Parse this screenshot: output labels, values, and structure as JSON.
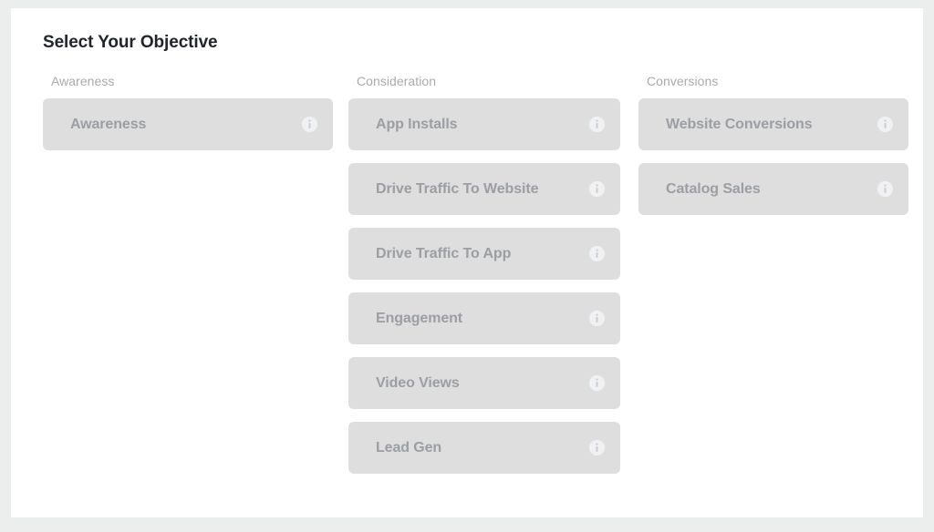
{
  "panel": {
    "title": "Select Your Objective"
  },
  "columns": [
    {
      "key": "awareness",
      "header": "Awareness",
      "items": [
        {
          "label": "Awareness",
          "info_icon": "info-circle-icon"
        }
      ]
    },
    {
      "key": "consideration",
      "header": "Consideration",
      "items": [
        {
          "label": "App Installs",
          "info_icon": "info-circle-icon"
        },
        {
          "label": "Drive Traffic To Website",
          "info_icon": "info-circle-icon"
        },
        {
          "label": "Drive Traffic To App",
          "info_icon": "info-circle-icon"
        },
        {
          "label": "Engagement",
          "info_icon": "info-circle-icon"
        },
        {
          "label": "Video Views",
          "info_icon": "info-circle-icon"
        },
        {
          "label": "Lead Gen",
          "info_icon": "info-circle-icon"
        }
      ]
    },
    {
      "key": "conversions",
      "header": "Conversions",
      "items": [
        {
          "label": "Website Conversions",
          "info_icon": "info-circle-icon"
        },
        {
          "label": "Catalog Sales",
          "info_icon": "info-circle-icon"
        }
      ]
    }
  ],
  "colors": {
    "page_background": "#eceded",
    "panel_background": "#ffffff",
    "card_background": "#dededf",
    "card_text": "#9b9ea2",
    "header_text": "#a8abae",
    "title_text": "#21242a",
    "info_icon_background": "#f0f1f2"
  }
}
